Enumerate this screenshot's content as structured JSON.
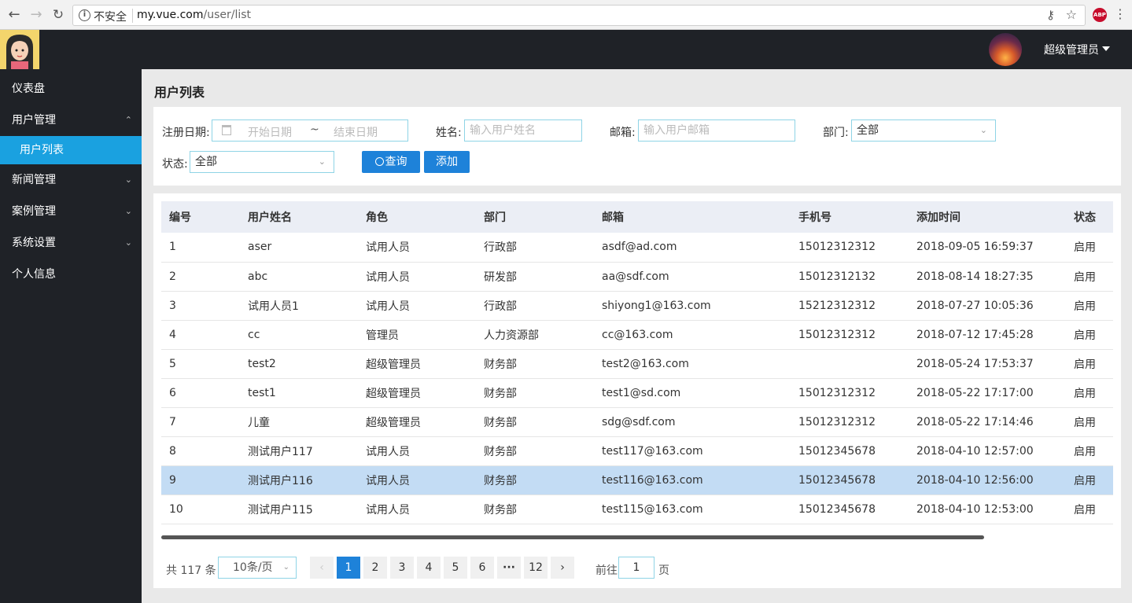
{
  "browser": {
    "security_label": "不安全",
    "url_host": "my.vue.com",
    "url_path": "/user/list"
  },
  "header": {
    "user_name": "超级管理员"
  },
  "sidebar": {
    "items": [
      {
        "label": "仪表盘"
      },
      {
        "label": "用户管理"
      },
      {
        "label": "用户列表"
      },
      {
        "label": "新闻管理"
      },
      {
        "label": "案例管理"
      },
      {
        "label": "系统设置"
      },
      {
        "label": "个人信息"
      }
    ]
  },
  "page": {
    "title": "用户列表"
  },
  "filters": {
    "date_label": "注册日期:",
    "start_placeholder": "开始日期",
    "range_sep": "~",
    "end_placeholder": "结束日期",
    "name_label": "姓名:",
    "name_placeholder": "输入用户姓名",
    "email_label": "邮箱:",
    "email_placeholder": "输入用户邮箱",
    "dept_label": "部门:",
    "dept_value": "全部",
    "status_label": "状态:",
    "status_value": "全部",
    "search_button": "查询",
    "add_button": "添加"
  },
  "table": {
    "columns": [
      "编号",
      "用户姓名",
      "角色",
      "部门",
      "邮箱",
      "手机号",
      "添加时间",
      "状态"
    ],
    "rows": [
      [
        "1",
        "aser",
        "试用人员",
        "行政部",
        "asdf@ad.com",
        "15012312312",
        "2018-09-05 16:59:37",
        "启用"
      ],
      [
        "2",
        "abc",
        "试用人员",
        "研发部",
        "aa@sdf.com",
        "15012312132",
        "2018-08-14 18:27:35",
        "启用"
      ],
      [
        "3",
        "试用人员1",
        "试用人员",
        "行政部",
        "shiyong1@163.com",
        "15212312312",
        "2018-07-27 10:05:36",
        "启用"
      ],
      [
        "4",
        "cc",
        "管理员",
        "人力资源部",
        "cc@163.com",
        "15012312312",
        "2018-07-12 17:45:28",
        "启用"
      ],
      [
        "5",
        "test2",
        "超级管理员",
        "财务部",
        "test2@163.com",
        "",
        "2018-05-24 17:53:37",
        "启用"
      ],
      [
        "6",
        "test1",
        "超级管理员",
        "财务部",
        "test1@sd.com",
        "15012312312",
        "2018-05-22 17:17:00",
        "启用"
      ],
      [
        "7",
        "儿童",
        "超级管理员",
        "财务部",
        "sdg@sdf.com",
        "15012312312",
        "2018-05-22 17:14:46",
        "启用"
      ],
      [
        "8",
        "测试用户117",
        "试用人员",
        "财务部",
        "test117@163.com",
        "15012345678",
        "2018-04-10 12:57:00",
        "启用"
      ],
      [
        "9",
        "测试用户116",
        "试用人员",
        "财务部",
        "test116@163.com",
        "15012345678",
        "2018-04-10 12:56:00",
        "启用"
      ],
      [
        "10",
        "测试用户115",
        "试用人员",
        "财务部",
        "test115@163.com",
        "15012345678",
        "2018-04-10 12:53:00",
        "启用"
      ]
    ]
  },
  "pagination": {
    "total": "共 117 条",
    "page_size": "10条/页",
    "pages": [
      "1",
      "2",
      "3",
      "4",
      "5",
      "6",
      "···",
      "12"
    ],
    "goto_label": "前往",
    "goto_value": "1",
    "page_suffix": "页"
  }
}
